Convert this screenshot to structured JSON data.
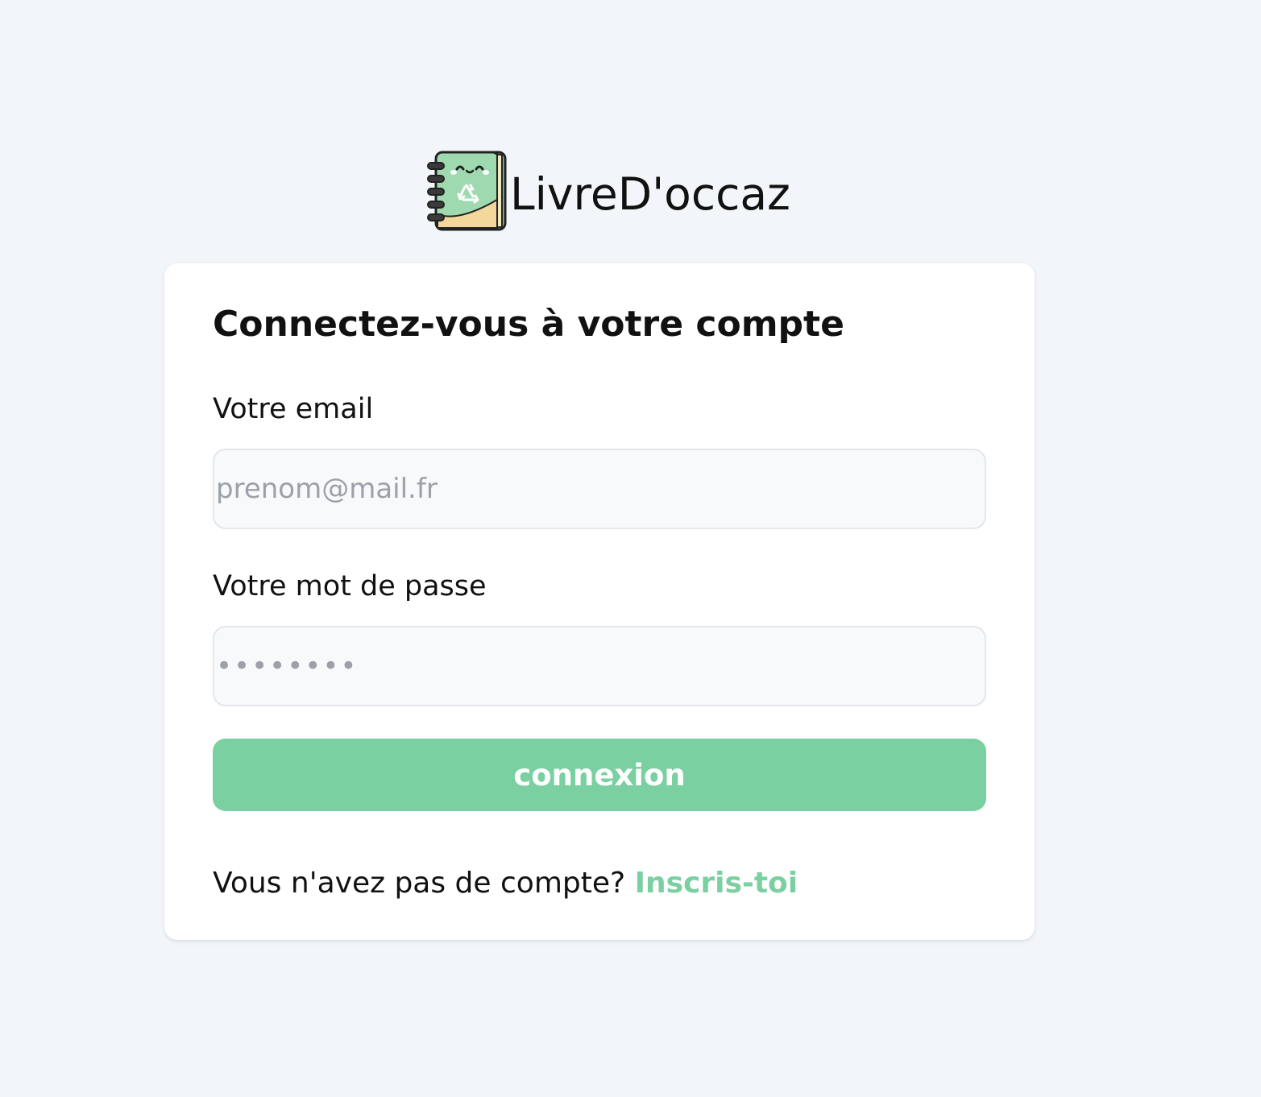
{
  "brand": {
    "name": "LivreD'occaz",
    "logo_icon": "recycled-notebook-icon"
  },
  "colors": {
    "background": "#f2f5f9",
    "accent": "#7ad0a0",
    "card": "#ffffff",
    "input_background": "#f8f9fb"
  },
  "login": {
    "title": "Connectez-vous à votre compte",
    "email": {
      "label": "Votre email",
      "placeholder": "prenom@mail.fr",
      "value": ""
    },
    "password": {
      "label": "Votre mot de passe",
      "placeholder": "••••••••",
      "value": ""
    },
    "submit_label": "connexion",
    "signup_prompt": "Vous n'avez pas de compte?",
    "signup_link": "Inscris-toi"
  }
}
